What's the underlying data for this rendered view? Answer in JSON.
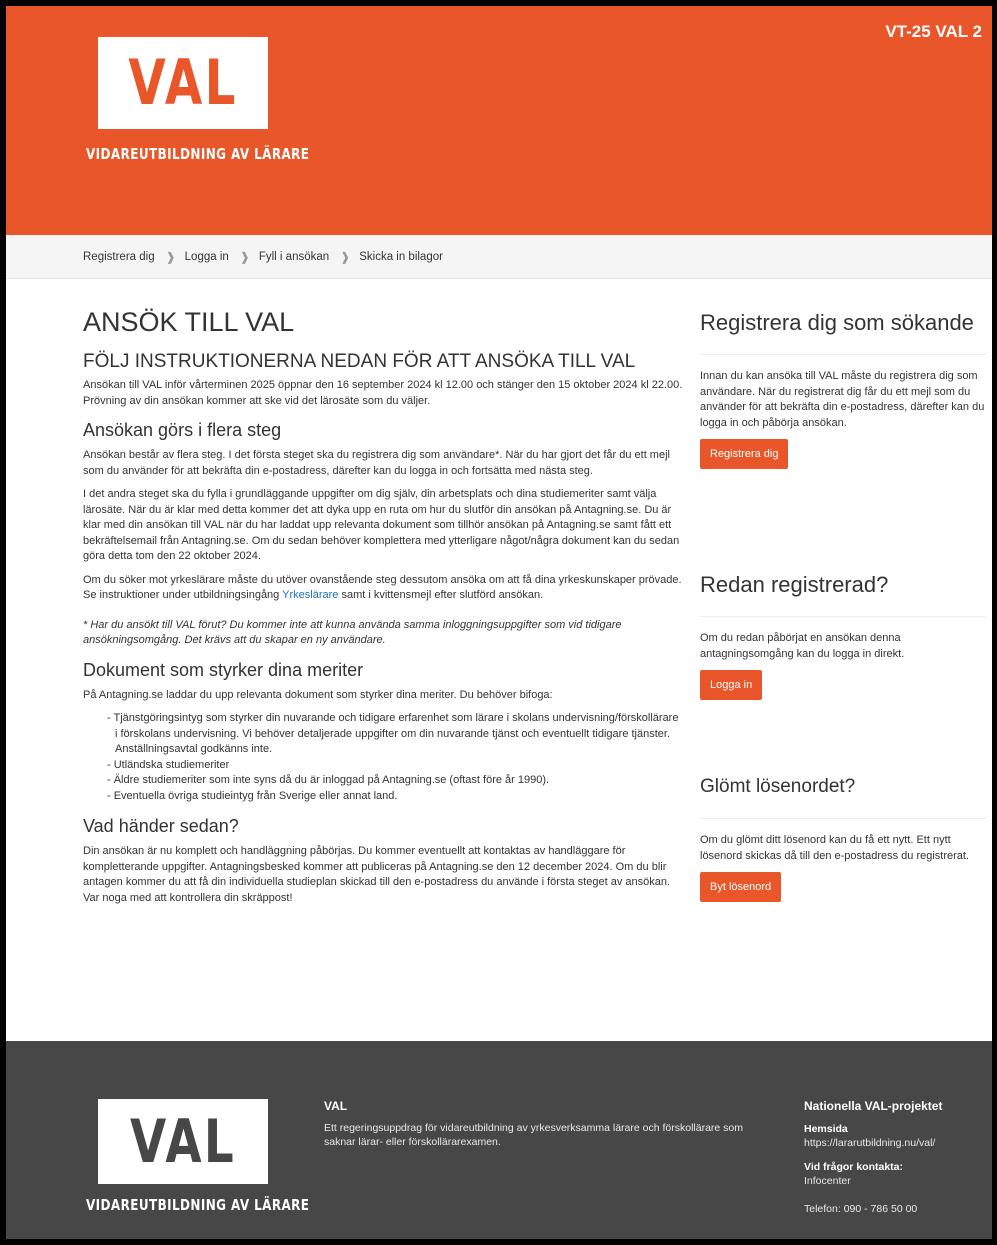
{
  "header": {
    "logo_word": "VAL",
    "logo_sub": "VIDAREUTBILDNING AV LÄRARE",
    "term": "VT-25 VAL 2"
  },
  "steps": [
    "Registrera dig",
    "Logga in",
    "Fyll i ansökan",
    "Skicka in bilagor"
  ],
  "main": {
    "title": "ANSÖK TILL VAL",
    "lead_heading": "FÖLJ INSTRUKTIONERNA NEDAN FÖR ATT ANSÖKA TILL VAL",
    "intro": "Ansökan till VAL inför vårterminen 2025 öppnar den 16 september 2024 kl 12.00 och stänger den 15 oktober 2024 kl 22.00. Prövning av din ansökan kommer att ske vid det lärosäte som du väljer.",
    "steps_heading": "Ansökan görs i flera steg",
    "steps_p1": "Ansökan består av flera steg. I det första steget ska du registrera dig som användare*. När du har gjort det får du ett mejl som du använder för att bekräfta din e-postadress, därefter kan du logga in och fortsätta med nästa steg.",
    "steps_p2": "I det andra steget ska du fylla i grundläggande uppgifter om dig själv, din arbetsplats och dina studiemeriter samt välja lärosäte. När du är klar med detta kommer det att dyka upp en ruta om hur du slutför din ansökan på Antagning.se. Du är klar med din ansökan till VAL när du har laddat upp relevanta dokument som tillhör ansökan på Antagning.se samt fått ett bekräftelsemail från Antagning.se. Om du sedan behöver komplettera med ytterligare något/några dokument kan du sedan göra detta tom den 22 oktober 2024.",
    "steps_p3_before": "Om du söker mot yrkeslärare måste du utöver ovanstående steg dessutom ansöka om att få dina yrkeskunskaper prövade. Se instruktioner under utbildningsingång ",
    "steps_p3_link": "Yrkeslärare",
    "steps_p3_after": " samt i kvittensmejl efter slutförd ansökan.",
    "note": "* Har du ansökt till VAL förut? Du kommer inte att kunna använda samma inloggningsuppgifter som vid tidigare ansökningsomgång. Det krävs att du skapar en ny användare.",
    "docs_heading": "Dokument som styrker dina meriter",
    "docs_intro": "På Antagning.se laddar du upp relevanta dokument som styrker dina meriter. Du behöver bifoga:",
    "docs_list": [
      "- Tjänstgöringsintyg som styrker din nuvarande och tidigare erfarenhet som lärare i skolans undervisning/förskollärare i förskolans undervisning. Vi behöver detaljerade uppgifter om din nuvarande tjänst och eventuellt tidigare tjänster. Anställningsavtal godkänns inte.",
      "- Utländska studiemeriter",
      "- Äldre studiemeriter som inte syns då du är inloggad på Antagning.se (oftast före år 1990).",
      "- Eventuella övriga studieintyg från Sverige eller annat land."
    ],
    "next_heading": "Vad händer sedan?",
    "next_p": "Din ansökan är nu komplett och handläggning påbörjas. Du kommer eventuellt att kontaktas av handläggare för kompletterande uppgifter. Antagningsbesked kommer att publiceras på Antagning.se den 12 december 2024. Om du blir antagen kommer du att få din individuella studieplan skickad till den e-postadress du använde i första steget av ansökan. Var noga med att kontrollera din skräppost!"
  },
  "sidebar": {
    "register_heading": "Registrera dig som sökande",
    "register_text": "Innan du kan ansöka till VAL måste du registrera dig som användare. När du registrerat dig får du ett mejl som du använder för att bekräfta din e-postadress, därefter kan du logga in och påbörja ansökan.",
    "register_button": "Registrera dig",
    "login_heading": "Redan registrerad?",
    "login_text": "Om du redan påbörjat en ansökan denna antagningsomgång kan du logga in direkt.",
    "login_button": "Logga in",
    "forgot_heading": "Glömt lösenordet?",
    "forgot_text": "Om du glömt ditt lösenord kan du få ett nytt. Ett nytt lösenord skickas då till den e-postadress du registrerat.",
    "forgot_button": "Byt lösenord"
  },
  "footer": {
    "logo_word": "VAL",
    "logo_sub": "VIDAREUTBILDNING AV LÄRARE",
    "mid_title": "VAL",
    "mid_text": "Ett regeringsuppdrag för vidareutbildning av yrkesverksamma lärare och förskollärare som saknar lärar- eller förskollärarexamen.",
    "right_title": "Nationella VAL-projektet",
    "homepage_label": "Hemsida",
    "homepage_url": "https://lararutbildning.nu/val/",
    "contact_label": "Vid frågor kontakta:",
    "contact_name": "Infocenter",
    "phone": "Telefon: 090 - 786 50 00"
  },
  "colors": {
    "brand_orange": "#e8562a",
    "footer_gray": "#474747",
    "link_blue": "#1e6fc0"
  }
}
